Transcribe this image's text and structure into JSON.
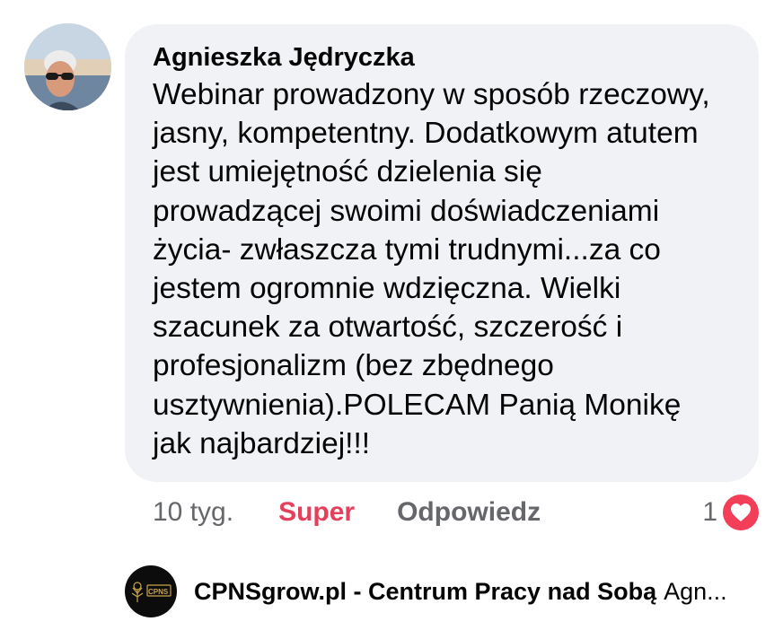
{
  "comment": {
    "author": "Agnieszka Jędryczka",
    "lines": [
      "Webinar prowadzony w sposób rzeczowy,",
      "jasny, kompetentny. Dodatkowym atutem",
      "jest umiejętność dzielenia się",
      "prowadzącej swoimi doświadczeniami",
      "życia- zwłaszcza tymi trudnymi...za co",
      "jestem ogromnie wdzięczna. Wielki",
      "szacunek za otwartość, szczerość i",
      "profesjonalizm (bez zbędnego",
      "usztywnienia).POLECAM Panią Monikę",
      "jak najbardziej!!!"
    ]
  },
  "actions": {
    "time": "10 tyg.",
    "react_label": "Super",
    "reply_label": "Odpowiedz",
    "reaction_count": "1",
    "reaction_icon": "heart-icon",
    "reaction_color": "#f33e58"
  },
  "reply": {
    "author": "CPNSgrow.pl - Centrum Pracy nad Sobą",
    "snippet": "Agn...",
    "logo_text": "CPNS"
  },
  "colors": {
    "bubble": "#f0f2f5",
    "secondary_text": "#65676b",
    "react_active": "#e4405c"
  }
}
